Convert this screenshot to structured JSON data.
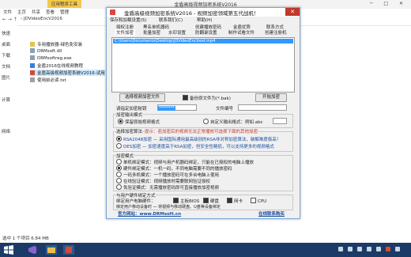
{
  "explorer": {
    "tools_tab": "应用程序工具",
    "title": "金盾高级视频加密系统V2016",
    "window_controls": "─ □ ✕",
    "ribbon_tabs": [
      "文件",
      "主页",
      "共享",
      "查看",
      "管理"
    ],
    "nav_arrows": "← → ↑",
    "address": "› JDVideoEncV2016",
    "nav_items": [
      "快速",
      "桌面",
      "下载",
      "文档",
      "图片",
      "计算",
      "网络"
    ],
    "files": [
      {
        "name": "专用播放器-绿色免安装",
        "icon": "folder-icon",
        "color": "#e8c04a"
      },
      {
        "name": "DRMsoft.dll",
        "icon": "dll-file-icon",
        "color": "#8aa0b8"
      },
      {
        "name": "DRMsoftreg.exe",
        "icon": "exe-file-icon",
        "color": "#8aa0b8"
      },
      {
        "name": "金盾2016在线视频教程",
        "icon": "web-link-icon",
        "color": "#3b7dd8"
      },
      {
        "name": "金盾高级视频加密系统V2016-试用",
        "icon": "app-icon",
        "color": "#d44a3a"
      },
      {
        "name": "使用前必读.txt",
        "icon": "txt-file-icon",
        "color": "#9aa0a6"
      }
    ],
    "status": "选中 1 个项目  6.84 MB"
  },
  "dialog": {
    "title": "金盾高级视频加密系统V2016 - 视频加密领域第五代战机！",
    "close": "✕",
    "menu": [
      "保存和加载设置(S)",
      "联系我们(C)",
      "帮助(H)"
    ],
    "tabs_row1": [
      "授权注册",
      "黑名单机器码",
      "创建播放密码",
      "金盾优势",
      "联系方式"
    ],
    "tabs_row2": [
      "文件加密",
      "批量加密",
      "水印设置",
      "防翻录设置",
      "制作试看文件",
      "创建注册机"
    ],
    "selected_file": "C:\\Users\\Documents\\Desktop\\JDVideoEnc\\test.mp4",
    "choose_file_btn": "选择视频加密文件",
    "backup_label": "备份原文件为(*.bak)",
    "start_btn": "开始加密",
    "password_label": "请指定加密秘钥",
    "password_value": "********",
    "file_no_label": "文件编号",
    "mode_group": "加密输出模式",
    "mode_opt1": "保留原始视频格式",
    "mode_opt2": "自定义输出格式：例如.abc",
    "algo_group": "选择加密算法",
    "algo_note": "提示：若加密后的视频无法正常播放可选择下面的其他加密",
    "algo_opt1": "RSA2048加密 — 采用国际通用最高级别的RSA非对称加密算法，破解难度极高！",
    "algo_opt2": "DES加密 — 加密速度高于RSA加密，但安全性略低，可以支持更多的视频格式",
    "play_group": "加密模式",
    "play_opts": [
      "单机绑定模式：视频与用户机器码绑定，只能在已授权的电脑上播放",
      "硬件绑定模式：一机一码，不同电脑需要不同的播放密码",
      "一码多机模式：一个播放密码可在多台电脑上使用",
      "在线验证模式：视频播放时需要联网验证授权",
      "免验证模式：无需播放密码即可直接播放加密视频"
    ],
    "bind_group": "与用户硬件绑定方式",
    "bind_label": "绑定用户电脑硬件：",
    "bind_opts": [
      "主板BIOS",
      "硬盘",
      "网卡",
      "CPU"
    ],
    "bind_note": "绑定用户移动设备时 — 将视频与移动硬盘、U盘等设备绑定",
    "footer_left": "官方网站：www.DRMsoft.cn",
    "footer_right": "在线联系购买"
  }
}
